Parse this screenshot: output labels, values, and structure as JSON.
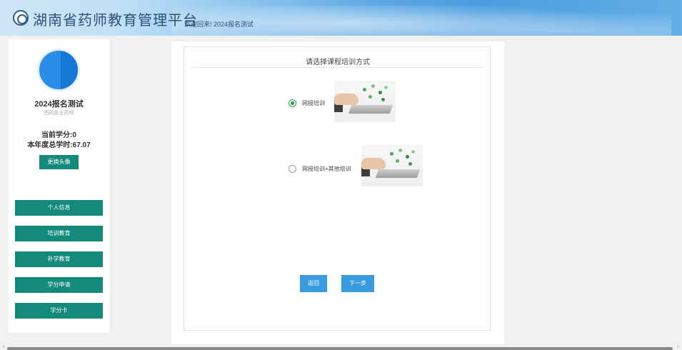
{
  "header": {
    "site_title": "湖南省药师教育管理平台",
    "welcome": "欢迎回来! 2024报名测试"
  },
  "sidebar": {
    "user_name": "2024报名测试",
    "user_role": "西药执业药师",
    "credit": "当前学分:0",
    "annual_hours": "本年度总学时:67.07",
    "change_avatar_label": "更换头像",
    "nav": [
      {
        "label": "个人信息"
      },
      {
        "label": "培训教育"
      },
      {
        "label": "补学教育"
      },
      {
        "label": "学分申请"
      },
      {
        "label": "学分卡"
      }
    ]
  },
  "main": {
    "title": "请选择课程培训方式",
    "options": [
      {
        "label": "网授培训",
        "selected": true
      },
      {
        "label": "网授培训+其他培训",
        "selected": false
      }
    ],
    "back_label": "返回",
    "next_label": "下一步"
  },
  "colors": {
    "nav_button": "#138a7a",
    "action_button": "#3a9ae0",
    "radio_checked": "#2a9a52"
  }
}
